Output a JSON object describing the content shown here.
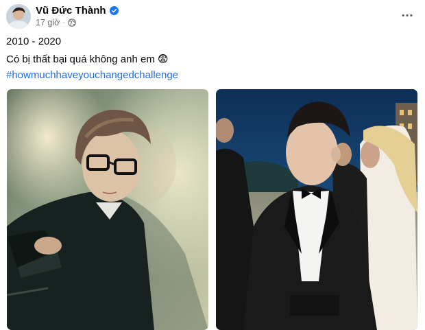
{
  "post": {
    "author_name": "Vũ Đức Thành",
    "timestamp": "17 giờ",
    "separator": "·",
    "privacy_icon": "globe-icon",
    "verified_icon": "verified-badge-icon",
    "more_icon": "more-horizontal-icon",
    "lines": [
      "2010 - 2020",
      "Có bị thất bại quá không anh em 😨"
    ],
    "hashtag": "#howmuchhaveyouchangedchallenge"
  },
  "colors": {
    "hashtag": "#216fdb",
    "verified": "#1877f2",
    "meta_text": "#65676b"
  },
  "photos": [
    {
      "subject": "young man with glasses and styled hair, 2010"
    },
    {
      "subject": "man in black tuxedo with bow tie at evening event, 2020"
    }
  ]
}
